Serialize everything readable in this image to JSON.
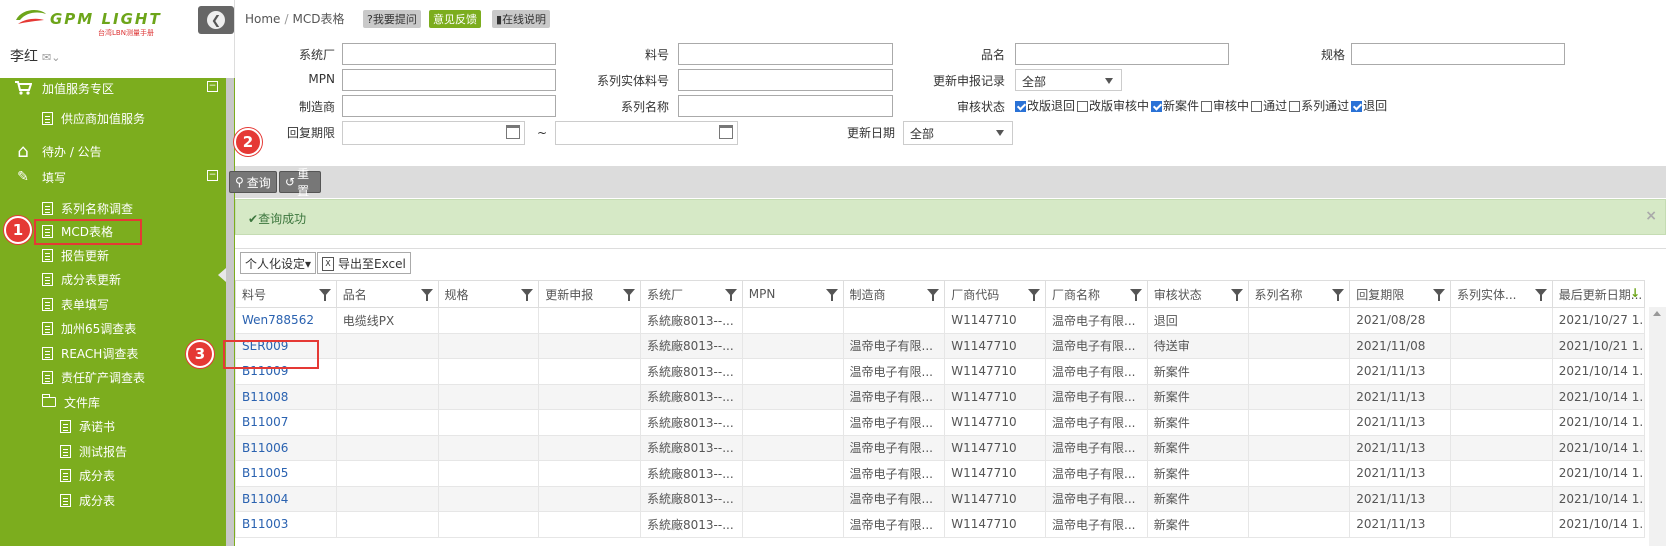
{
  "brand": {
    "logo_text": "GPM LIGHT",
    "logo_sub": "台湾LBN测量手册"
  },
  "user": {
    "name": "李红"
  },
  "sidebar": {
    "items": [
      {
        "label": "加值服务专区",
        "icon": "cart-icon",
        "level": 0,
        "collapsible": true
      },
      {
        "label": "供应商加值服务",
        "icon": "document-icon",
        "level": 1
      },
      {
        "label": "待办 / 公告",
        "icon": "home-icon",
        "level": 0
      },
      {
        "label": "填写",
        "icon": "edit-icon",
        "level": 0,
        "collapsible": true
      },
      {
        "label": "系列名称调查",
        "icon": "document-icon",
        "level": 1
      },
      {
        "label": "MCD表格",
        "icon": "document-icon",
        "level": 1,
        "active": true
      },
      {
        "label": "报告更新",
        "icon": "document-icon",
        "level": 1
      },
      {
        "label": "成分表更新",
        "icon": "document-icon",
        "level": 1
      },
      {
        "label": "表单填写",
        "icon": "document-icon",
        "level": 1
      },
      {
        "label": "加州65调查表",
        "icon": "document-icon",
        "level": 1
      },
      {
        "label": "REACH调查表",
        "icon": "document-icon",
        "level": 1
      },
      {
        "label": "责任矿产调查表",
        "icon": "document-icon",
        "level": 1
      },
      {
        "label": "文件库",
        "icon": "folder-icon",
        "level": 1
      },
      {
        "label": "承诺书",
        "icon": "document-icon",
        "level": 2
      },
      {
        "label": "测试报告",
        "icon": "document-icon",
        "level": 2
      },
      {
        "label": "成分表",
        "icon": "document-icon",
        "level": 2
      },
      {
        "label": "成分表",
        "icon": "document-icon",
        "level": 2
      }
    ]
  },
  "breadcrumb": {
    "home": "Home",
    "separator": "/",
    "current": "MCD表格"
  },
  "toolbar": {
    "ask": "?我要提问",
    "feedback": "意见反馈",
    "online_help": "在线说明"
  },
  "form": {
    "system_factory": "系统厂",
    "part_no": "料号",
    "product_name": "品名",
    "spec": "规格",
    "mpn": "MPN",
    "series_entity_part": "系列实体料号",
    "update_record": "更新申报记录",
    "update_record_value": "全部",
    "manufacturer": "制造商",
    "series_name": "系列名称",
    "review_status": "审核状态",
    "reply_deadline": "回复期限",
    "tilde": "~",
    "update_date": "更新日期",
    "update_date_value": "全部",
    "status_options": [
      {
        "label": "改版退回",
        "checked": true
      },
      {
        "label": "改版审核中",
        "checked": false
      },
      {
        "label": "新案件",
        "checked": true
      },
      {
        "label": "审核中",
        "checked": false
      },
      {
        "label": "通过",
        "checked": false
      },
      {
        "label": "系列通过",
        "checked": false
      },
      {
        "label": "退回",
        "checked": true
      }
    ]
  },
  "actions": {
    "query": "查询",
    "reset": "重置"
  },
  "alert": {
    "message": "查询成功",
    "close": "×"
  },
  "grid_tools": {
    "personalize": "个人化设定",
    "export": "导出至Excel"
  },
  "table": {
    "columns": [
      "料号",
      "品名",
      "规格",
      "更新申报",
      "系统厂",
      "MPN",
      "制造商",
      "厂商代码",
      "厂商名称",
      "审核状态",
      "系列名称",
      "回复期限",
      "系列实体...",
      "最后更新日期..."
    ],
    "rows": [
      [
        "Wen788562",
        "电缆线PX",
        "",
        "",
        "系統廠8013--...",
        "",
        "",
        "W1147710",
        "温帝电子有限...",
        "退回",
        "",
        "2021/08/28",
        "",
        "2021/10/27 1..."
      ],
      [
        "SER009",
        "",
        "",
        "",
        "系統廠8013--...",
        "",
        "温帝电子有限...",
        "W1147710",
        "温帝电子有限...",
        "待送审",
        "",
        "2021/11/08",
        "",
        "2021/10/21 1..."
      ],
      [
        "B11009",
        "",
        "",
        "",
        "系統廠8013--...",
        "",
        "温帝电子有限...",
        "W1147710",
        "温帝电子有限...",
        "新案件",
        "",
        "2021/11/13",
        "",
        "2021/10/14 1..."
      ],
      [
        "B11008",
        "",
        "",
        "",
        "系統廠8013--...",
        "",
        "温帝电子有限...",
        "W1147710",
        "温帝电子有限...",
        "新案件",
        "",
        "2021/11/13",
        "",
        "2021/10/14 1..."
      ],
      [
        "B11007",
        "",
        "",
        "",
        "系統廠8013--...",
        "",
        "温帝电子有限...",
        "W1147710",
        "温帝电子有限...",
        "新案件",
        "",
        "2021/11/13",
        "",
        "2021/10/14 1..."
      ],
      [
        "B11006",
        "",
        "",
        "",
        "系統廠8013--...",
        "",
        "温帝电子有限...",
        "W1147710",
        "温帝电子有限...",
        "新案件",
        "",
        "2021/11/13",
        "",
        "2021/10/14 1..."
      ],
      [
        "B11005",
        "",
        "",
        "",
        "系統廠8013--...",
        "",
        "温帝电子有限...",
        "W1147710",
        "温帝电子有限...",
        "新案件",
        "",
        "2021/11/13",
        "",
        "2021/10/14 1..."
      ],
      [
        "B11004",
        "",
        "",
        "",
        "系統廠8013--...",
        "",
        "温帝电子有限...",
        "W1147710",
        "温帝电子有限...",
        "新案件",
        "",
        "2021/11/13",
        "",
        "2021/10/14 1..."
      ],
      [
        "B11003",
        "",
        "",
        "",
        "系統廠8013--...",
        "",
        "温帝电子有限...",
        "W1147710",
        "温帝电子有限...",
        "新案件",
        "",
        "2021/11/13",
        "",
        "2021/10/14 1..."
      ]
    ]
  },
  "annotations": [
    "1",
    "2",
    "3"
  ],
  "colors": {
    "sidebar": "#7cad1e",
    "accent_red": "#e53935",
    "link": "#2a62b0",
    "success_bg": "#d6e9c6"
  }
}
